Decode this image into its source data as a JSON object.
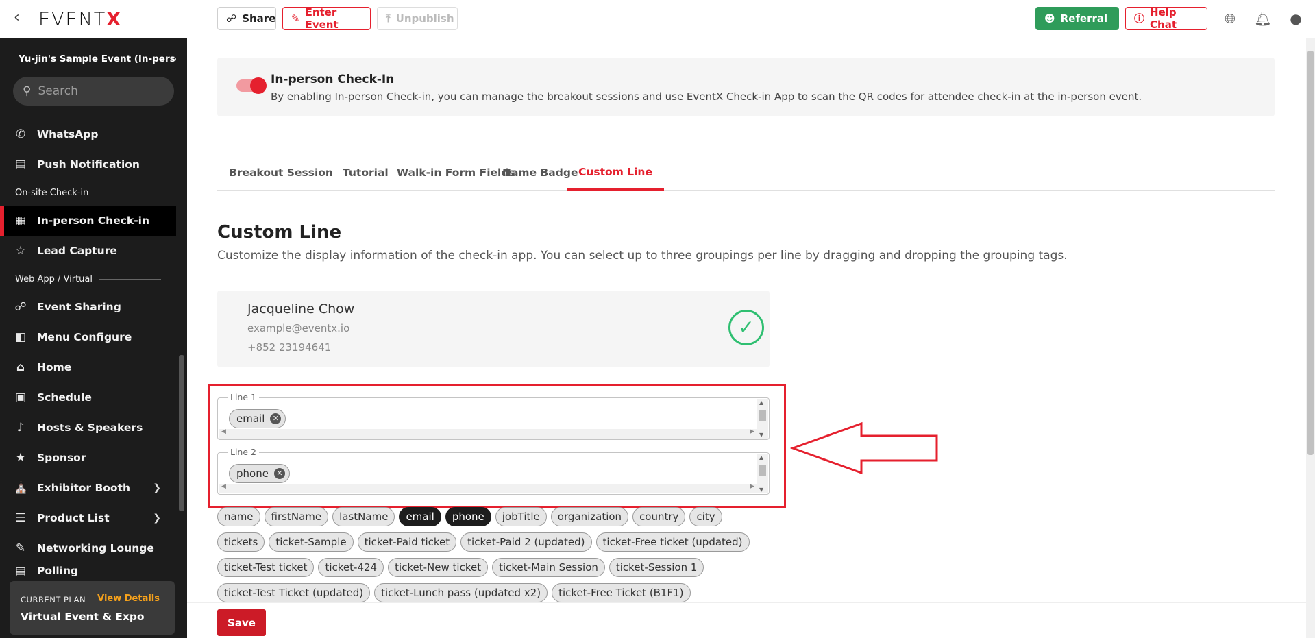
{
  "topbar": {
    "back_icon": "chevron-left",
    "logo": {
      "prefix": "EVENT",
      "suffix": "X"
    },
    "share_label": "Share",
    "enter_event_label": "Enter Event",
    "unpublish_label": "Unpublish",
    "referral_label": "Referral",
    "help_chat_label": "Help Chat"
  },
  "sidebar": {
    "event_title": "Yu-jin's Sample Event (In-perso...",
    "search_placeholder": "Search",
    "items": [
      {
        "label": "WhatsApp",
        "icon": "whatsapp-icon"
      },
      {
        "label": "Push Notification",
        "icon": "push-notification-icon"
      },
      {
        "group": "On-site Check-in"
      },
      {
        "label": "In-person Check-in",
        "icon": "qr-code-icon",
        "active": true
      },
      {
        "label": "Lead Capture",
        "icon": "lead-capture-icon"
      },
      {
        "group": "Web App / Virtual"
      },
      {
        "label": "Event Sharing",
        "icon": "share-icon"
      },
      {
        "label": "Menu Configure",
        "icon": "menu-configure-icon"
      },
      {
        "label": "Home",
        "icon": "home-icon"
      },
      {
        "label": "Schedule",
        "icon": "calendar-icon"
      },
      {
        "label": "Hosts & Speakers",
        "icon": "microphone-icon"
      },
      {
        "label": "Sponsor",
        "icon": "sponsor-icon"
      },
      {
        "label": "Exhibitor Booth",
        "icon": "booth-icon",
        "expandable": true
      },
      {
        "label": "Product List",
        "icon": "product-list-icon",
        "expandable": true
      },
      {
        "label": "Networking Lounge",
        "icon": "networking-icon"
      },
      {
        "label": "Polling",
        "icon": "polling-icon"
      }
    ],
    "plan": {
      "label": "CURRENT PLAN",
      "view_details": "View Details",
      "name": "Virtual Event & Expo"
    }
  },
  "banner": {
    "title": "In-person Check-In",
    "description": "By enabling In-person Check-in, you can manage the breakout sessions and use EventX Check-in App to scan the QR codes for attendee check-in at the in-person event.",
    "enabled": true
  },
  "tabs": [
    "Breakout Session",
    "Tutorial",
    "Walk-in Form Fields",
    "Name Badge",
    "Custom Line"
  ],
  "active_tab": "Custom Line",
  "section": {
    "title": "Custom Line",
    "description": "Customize the display information of the check-in app. You can select up to three groupings per line by dragging and dropping the grouping tags."
  },
  "preview": {
    "name": "Jacqueline Chow",
    "email": "example@eventx.io",
    "phone": "+852 23194641"
  },
  "lines": [
    {
      "legend": "Line 1",
      "chips": [
        "email"
      ]
    },
    {
      "legend": "Line 2",
      "chips": [
        "phone"
      ]
    }
  ],
  "tag_rows": [
    [
      "name",
      "firstName",
      "lastName",
      "email",
      "phone",
      "jobTitle",
      "organization",
      "country",
      "city"
    ],
    [
      "tickets",
      "ticket-Sample",
      "ticket-Paid ticket",
      "ticket-Paid 2 (updated)",
      "ticket-Free ticket (updated)"
    ],
    [
      "ticket-Test ticket",
      "ticket-424",
      "ticket-New ticket",
      "ticket-Main Session",
      "ticket-Session 1"
    ],
    [
      "ticket-Test Ticket (updated)",
      "ticket-Lunch pass (updated x2)",
      "ticket-Free Ticket (B1F1)"
    ]
  ],
  "selected_tags": [
    "email",
    "phone"
  ],
  "save_label": "Save",
  "colors": {
    "brand_red": "#e5202e",
    "referral_green": "#2f9c5a",
    "sidebar_bg": "#1c1c1c",
    "plan_link": "#f7a21b"
  }
}
